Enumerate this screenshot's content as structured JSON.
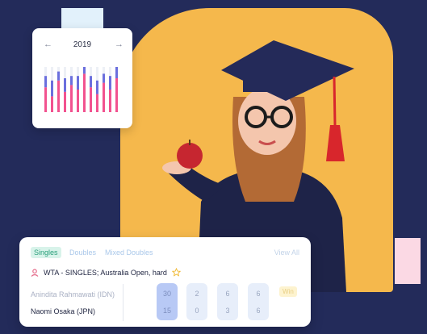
{
  "colors": {
    "background": "#232b5a",
    "photo_panel": "#f5b84c",
    "bar_pink": "#f2528f",
    "bar_blue": "#6b6fdd",
    "accent_green": "#2ca07c"
  },
  "calendar": {
    "year": "2019",
    "prev_icon": "←",
    "next_icon": "→",
    "bar_series": {
      "pink": [
        0.55,
        0.35,
        0.7,
        0.45,
        0.6,
        0.5,
        0.85,
        0.55,
        0.4,
        0.65,
        0.5,
        0.75
      ],
      "blue": [
        0.25,
        0.35,
        0.2,
        0.3,
        0.2,
        0.3,
        0.15,
        0.25,
        0.3,
        0.2,
        0.3,
        0.25
      ]
    }
  },
  "scorecard": {
    "tabs": [
      {
        "label": "Singles",
        "active": true
      },
      {
        "label": "Doubles",
        "active": false
      },
      {
        "label": "Mixed Doubles",
        "active": false
      }
    ],
    "view_all": "View All",
    "event": "WTA - SINGLES; Australia Open, hard",
    "players": [
      {
        "name": "Anindita Rahmawati (IDN)",
        "dim": true
      },
      {
        "name": "Naomi Osaka (JPN)",
        "dim": false
      }
    ],
    "sets": [
      {
        "top": "30",
        "bottom": "15",
        "active": true
      },
      {
        "top": "2",
        "bottom": "0",
        "active": false
      },
      {
        "top": "6",
        "bottom": "3",
        "active": false
      },
      {
        "top": "6",
        "bottom": "6",
        "active": false
      }
    ],
    "badge": "Win"
  }
}
